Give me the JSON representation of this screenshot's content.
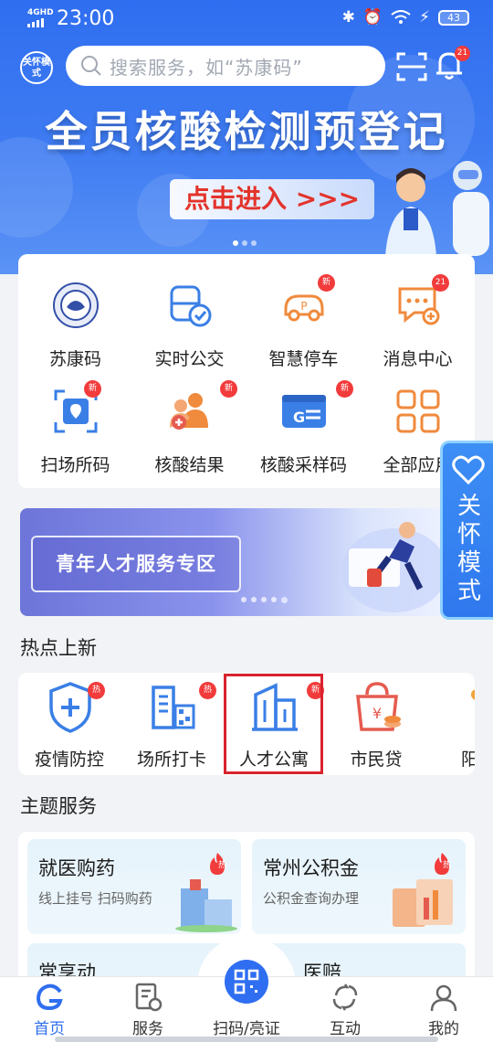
{
  "status": {
    "network": "4GHD",
    "time": "23:00",
    "battery": "43"
  },
  "header": {
    "care_label": "关怀模式",
    "search_placeholder": "搜索服务，如“苏康码”",
    "notification_count": "21"
  },
  "banner": {
    "title": "全员核酸检测预登记",
    "cta": "点击进入 >>>"
  },
  "grid": [
    {
      "label": "苏康码",
      "badge": "",
      "icon": "sukang-seal-icon"
    },
    {
      "label": "实时公交",
      "badge": "",
      "icon": "bus-icon"
    },
    {
      "label": "智慧停车",
      "badge": "新",
      "icon": "parking-car-icon"
    },
    {
      "label": "消息中心",
      "badge": "21",
      "icon": "message-icon"
    },
    {
      "label": "扫场所码",
      "badge": "新",
      "icon": "scan-location-icon"
    },
    {
      "label": "核酸结果",
      "badge": "新",
      "icon": "people-result-icon"
    },
    {
      "label": "核酸采样码",
      "badge": "新",
      "icon": "sample-card-icon"
    },
    {
      "label": "全部应用",
      "badge": "",
      "icon": "grid-apps-icon"
    }
  ],
  "side_care": {
    "label": "关怀模式"
  },
  "talent_banner": {
    "title": "青年人才服务专区"
  },
  "hot": {
    "title": "热点上新",
    "items": [
      {
        "label": "疫情防控",
        "badge": "热",
        "icon": "shield-plus-icon"
      },
      {
        "label": "场所打卡",
        "badge": "热",
        "icon": "building-qr-icon"
      },
      {
        "label": "人才公寓",
        "badge": "新",
        "icon": "apartment-icon"
      },
      {
        "label": "市民贷",
        "badge": "",
        "icon": "money-bag-icon"
      },
      {
        "label": "阳光",
        "badge": "",
        "icon": "sun-icon"
      }
    ]
  },
  "theme": {
    "title": "主题服务",
    "tiles": [
      {
        "title": "就医购药",
        "subtitle": "线上挂号 扫码购药",
        "badge": "热"
      },
      {
        "title": "常州公积金",
        "subtitle": "公积金查询办理",
        "badge": "热"
      },
      {
        "title": "常享动",
        "subtitle": ""
      },
      {
        "title": "医赔",
        "subtitle": ""
      }
    ]
  },
  "nav": [
    {
      "label": "首页",
      "icon": "home-icon"
    },
    {
      "label": "服务",
      "icon": "service-icon"
    },
    {
      "label": "扫码/亮证",
      "icon": "qr-scan-icon"
    },
    {
      "label": "互动",
      "icon": "interact-icon"
    },
    {
      "label": "我的",
      "icon": "profile-icon"
    }
  ],
  "colors": {
    "primary": "#2f6ef0",
    "badge": "#f23b3b",
    "highlight": "#d9232f",
    "icon_blue": "#3a7fe6",
    "icon_orange": "#f08a3c"
  }
}
